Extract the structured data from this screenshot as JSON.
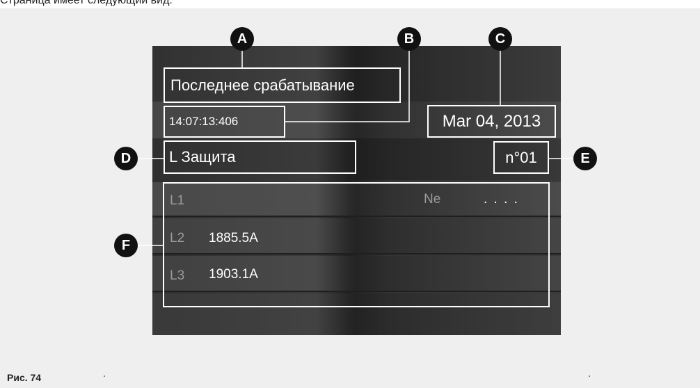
{
  "page": {
    "caption_top": "Страница имеет следующий вид:",
    "figure_caption": "Рис. 74"
  },
  "screen": {
    "title": "Последнее срабатывание",
    "time": "14:07:13:406",
    "date": "Mar 04, 2013",
    "protection": "L Защита",
    "trip_number": "n°01",
    "measurements": [
      {
        "phase": "L1",
        "value": ""
      },
      {
        "phase": "L2",
        "value": "1885.5A"
      },
      {
        "phase": "L3",
        "value": "1903.1A"
      }
    ],
    "neutral_label": "Ne",
    "neutral_value": ". . . ."
  },
  "markers": {
    "A": "A",
    "B": "B",
    "C": "C",
    "D": "D",
    "E": "E",
    "F": "F"
  },
  "colors": {
    "marker_fill": "#111111",
    "box_border": "#ffffff",
    "screen_dark": "#2f2f2f",
    "figure_background": "#efefef"
  }
}
